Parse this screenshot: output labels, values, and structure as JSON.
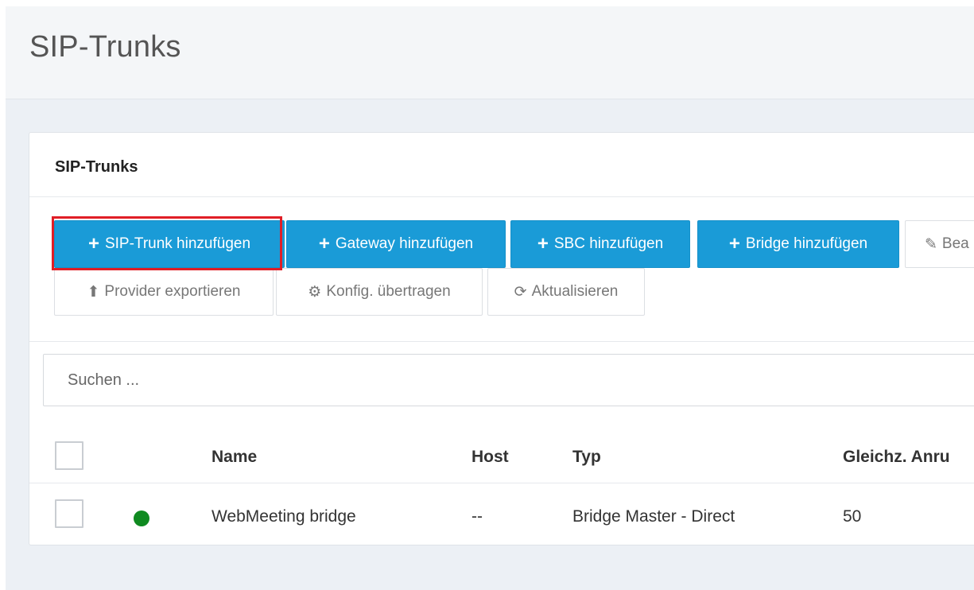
{
  "page": {
    "title": "SIP-Trunks"
  },
  "panel": {
    "title": "SIP-Trunks"
  },
  "toolbar": {
    "add_sip_trunk": "SIP-Trunk hinzufügen",
    "add_gateway": "Gateway hinzufügen",
    "add_sbc": "SBC hinzufügen",
    "add_bridge": "Bridge hinzufügen",
    "edit": "Bea",
    "export_provider": "Provider exportieren",
    "transfer_config": "Konfig. übertragen",
    "refresh": "Aktualisieren",
    "plus_glyph": "+",
    "pencil_glyph": "✎",
    "upload_glyph": "⬆",
    "gear_glyph": "⚙",
    "refresh_glyph": "⟳"
  },
  "search": {
    "placeholder": "Suchen ..."
  },
  "table": {
    "columns": [
      "Name",
      "Host",
      "Typ",
      "Gleichz. Anru"
    ],
    "rows": [
      {
        "status": "online",
        "status_color": "#0f8a20",
        "name": "WebMeeting bridge",
        "host": "--",
        "type": "Bridge Master - Direct",
        "concurrent": "50"
      }
    ]
  },
  "colors": {
    "primary": "#1a9bd7",
    "highlight": "#e01e26",
    "status_online": "#0f8a20"
  }
}
